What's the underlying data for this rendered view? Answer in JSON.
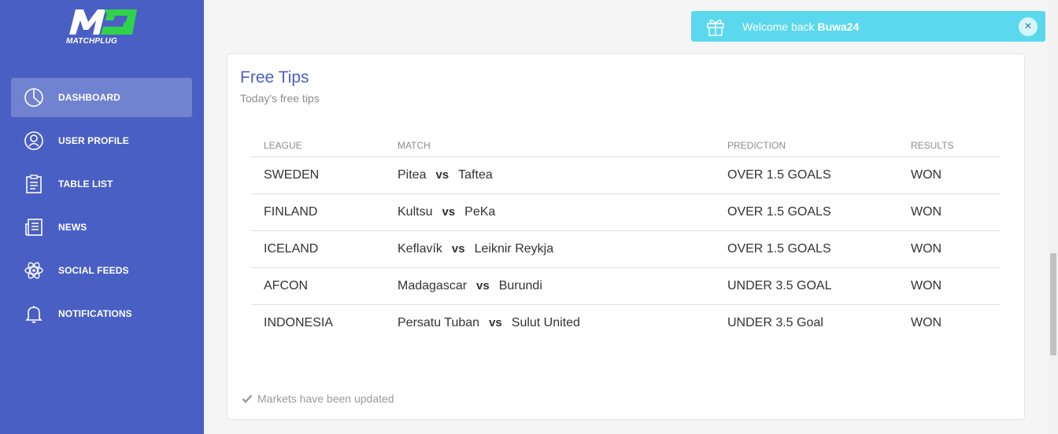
{
  "brand": {
    "logo_text": "MATCHPLUG",
    "logo_icon": "mp-logo-icon",
    "accent_color": "#4a5fc4",
    "logo_green": "#2fd34a"
  },
  "sidebar": {
    "items": [
      {
        "label": "DASHBOARD",
        "icon": "dashboard-pie-icon",
        "active": true
      },
      {
        "label": "USER PROFILE",
        "icon": "user-profile-icon",
        "active": false
      },
      {
        "label": "TABLE LIST",
        "icon": "clipboard-icon",
        "active": false
      },
      {
        "label": "NEWS",
        "icon": "newspaper-icon",
        "active": false
      },
      {
        "label": "SOCIAL FEEDS",
        "icon": "atom-icon",
        "active": false
      },
      {
        "label": "NOTIFICATIONS",
        "icon": "bell-icon",
        "active": false
      }
    ]
  },
  "toast": {
    "prefix": "Welcome back",
    "user": "Buwa24",
    "close_symbol": "×",
    "icon": "gift-icon",
    "color": "#5bd8ee"
  },
  "card": {
    "title": "Free Tips",
    "subtitle": "Today's free tips",
    "footer": "Markets have been updated",
    "footer_icon": "check-icon"
  },
  "table": {
    "headers": {
      "league": "LEAGUE",
      "match": "MATCH",
      "prediction": "PREDICTION",
      "results": "RESULTS"
    },
    "vs_label": "vs",
    "rows": [
      {
        "league": "SWEDEN",
        "home": "Pitea",
        "away": "Taftea",
        "prediction": "OVER 1.5 GOALS",
        "result": "WON"
      },
      {
        "league": "FINLAND",
        "home": "Kultsu",
        "away": "PeKa",
        "prediction": "OVER 1.5 GOALS",
        "result": "WON"
      },
      {
        "league": "ICELAND",
        "home": "Keflavík",
        "away": "Leiknir Reykja",
        "prediction": "OVER 1.5 GOALS",
        "result": "WON"
      },
      {
        "league": "AFCON",
        "home": "Madagascar",
        "away": "Burundi",
        "prediction": "UNDER 3.5 GOAL",
        "result": "WON"
      },
      {
        "league": "INDONESIA",
        "home": "Persatu Tuban",
        "away": "Sulut United",
        "prediction": "UNDER 3.5 Goal",
        "result": "WON"
      }
    ]
  }
}
